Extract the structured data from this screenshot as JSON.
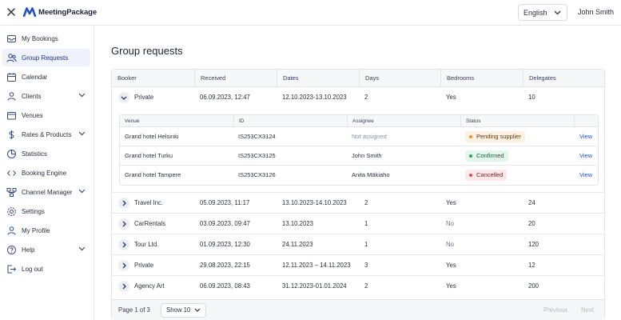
{
  "app": {
    "brand": "MeetingPackage"
  },
  "topbar": {
    "language": "English",
    "user_name": "John Smith"
  },
  "sidebar": {
    "items": [
      {
        "label": "My Bookings",
        "icon": "inbox-icon",
        "active": false,
        "expandable": false
      },
      {
        "label": "Group Requests",
        "icon": "group-icon",
        "active": true,
        "expandable": false
      },
      {
        "label": "Calendar",
        "icon": "calendar-icon",
        "active": false,
        "expandable": false
      },
      {
        "label": "Clients",
        "icon": "clients-icon",
        "active": false,
        "expandable": true
      },
      {
        "label": "Venues",
        "icon": "venues-icon",
        "active": false,
        "expandable": false
      },
      {
        "label": "Rates & Products",
        "icon": "dollar-icon",
        "active": false,
        "expandable": true
      },
      {
        "label": "Statistics",
        "icon": "pie-chart-icon",
        "active": false,
        "expandable": false
      },
      {
        "label": "Booking Engine",
        "icon": "code-icon",
        "active": false,
        "expandable": false
      },
      {
        "label": "Channel Manager",
        "icon": "channel-icon",
        "active": false,
        "expandable": true
      },
      {
        "label": "Settings",
        "icon": "gear-icon",
        "active": false,
        "expandable": false
      },
      {
        "label": "My Profile",
        "icon": "user-icon",
        "active": false,
        "expandable": false
      },
      {
        "label": "Help",
        "icon": "help-icon",
        "active": false,
        "expandable": true
      },
      {
        "label": "Log out",
        "icon": "logout-icon",
        "active": false,
        "expandable": false
      }
    ]
  },
  "main": {
    "title": "Group requests",
    "columns": [
      "Booker",
      "Received",
      "Dates",
      "Days",
      "Bedrooms",
      "Delegates"
    ],
    "expanded_row": {
      "booker": "Private",
      "received": "06.09.2023, 12:47",
      "dates": "12.10.2023-13.10.2023",
      "days": "2",
      "bedrooms": "Yes",
      "delegates": "10"
    },
    "sub_columns": [
      "Venue",
      "ID",
      "Assignee",
      "Status"
    ],
    "sub_rows": [
      {
        "venue": "Grand hotel Helsinki",
        "id": "IS253CX3124",
        "assignee": "Not assigned",
        "status": "Pending supplier",
        "action": "View"
      },
      {
        "venue": "Grand hotel Turku",
        "id": "IS253CX3125",
        "assignee": "John Smith",
        "status": "Confirmed",
        "action": "View"
      },
      {
        "venue": "Grand hotel Tampere",
        "id": "IS253CX3126",
        "assignee": "Anita Mäkiaho",
        "status": "Cancelled",
        "action": "View"
      }
    ],
    "rows": [
      {
        "booker": "Travel Inc.",
        "received": "05.09.2023, 11:17",
        "dates": "13.10.2023-14.10.2023",
        "days": "2",
        "bedrooms": "Yes",
        "delegates": "24"
      },
      {
        "booker": "CarRentals",
        "received": "03.09.2023, 09:47",
        "dates": "13.10.2023",
        "days": "1",
        "bedrooms": "No",
        "delegates": "20"
      },
      {
        "booker": "Tour Ltd.",
        "received": "01.09.2023, 12:30",
        "dates": "24.11.2023",
        "days": "1",
        "bedrooms": "No",
        "delegates": "120"
      },
      {
        "booker": "Private",
        "received": "29.08.2023, 22:15",
        "dates": "12.11.2023 – 14.11.2023",
        "days": "3",
        "bedrooms": "Yes",
        "delegates": "12"
      },
      {
        "booker": "Agency Art",
        "received": "06.09.2023, 08:43",
        "dates": "31.12.2023-01.01.2024",
        "days": "2",
        "bedrooms": "Yes",
        "delegates": "200"
      }
    ],
    "pagination": {
      "page_info": "Page 1 of 3",
      "page_size": "Show 10",
      "previous": "Previous",
      "next": "Next"
    }
  },
  "colors": {
    "accent": "#2450c8",
    "pending_bg": "#fdf1e4",
    "pending_dot": "#f0962f",
    "confirmed_bg": "#e5f6ec",
    "confirmed_dot": "#27a55c",
    "cancelled_bg": "#fde8ea",
    "cancelled_dot": "#e5485a"
  }
}
